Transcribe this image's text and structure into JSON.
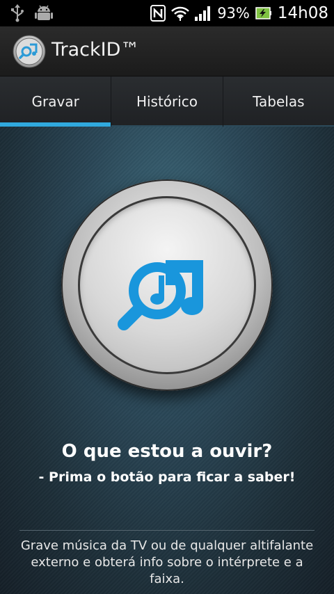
{
  "status_bar": {
    "icons": [
      "usb-icon",
      "android-debug-icon",
      "nfc-icon",
      "wifi-icon",
      "signal-icon",
      "battery-charging-icon"
    ],
    "battery": "93%",
    "time": "14h08"
  },
  "app": {
    "title": "TrackID™",
    "accent": "#30a9de"
  },
  "tabs": [
    {
      "label": "Gravar",
      "active": true
    },
    {
      "label": "Histórico",
      "active": false
    },
    {
      "label": "Tabelas",
      "active": false
    }
  ],
  "main": {
    "record_button_icon": "trackid-search-music-icon",
    "prompt_title": "O que estou a ouvir?",
    "prompt_subtitle": "- Prima o botão para ficar a saber!",
    "hint_line1": "Grave música da TV ou de qualquer altifalante",
    "hint_line2": "externo e obterá info sobre o intérprete e a faixa."
  }
}
